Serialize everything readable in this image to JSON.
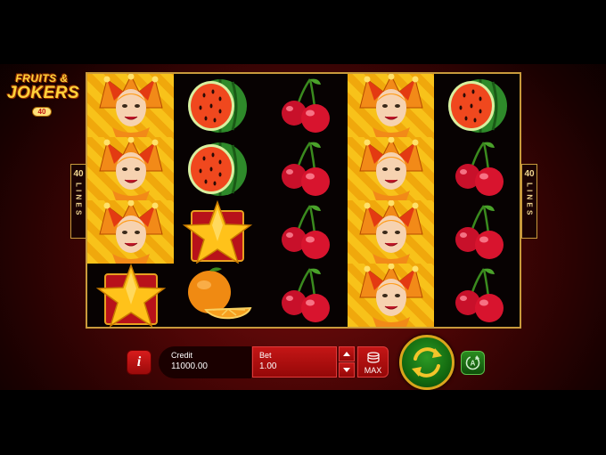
{
  "game": {
    "logo_line1": "FRUITS &",
    "logo_line2": "JOKERS",
    "logo_badge": "40"
  },
  "lines_indicator": {
    "left_number": "40",
    "left_word": "L I N E S",
    "right_number": "40",
    "right_word": "L I N E S"
  },
  "reels": [
    [
      "joker",
      "joker",
      "joker",
      "star"
    ],
    [
      "watermelon",
      "watermelon",
      "star",
      "orange"
    ],
    [
      "cherry",
      "cherry",
      "cherry",
      "cherry"
    ],
    [
      "joker",
      "joker",
      "joker",
      "joker"
    ],
    [
      "watermelon",
      "cherry",
      "cherry",
      "cherry"
    ]
  ],
  "controls": {
    "info_icon": "i",
    "credit_label": "Credit",
    "credit_value": "11000.00",
    "bet_label": "Bet",
    "bet_value": "1.00",
    "max_label": "MAX"
  },
  "colors": {
    "background": "#4a0505",
    "reel_frame": "#c89a3c",
    "bet_red": "#c41616",
    "spin_green": "#136a10",
    "spin_ring": "#d9a51c"
  }
}
